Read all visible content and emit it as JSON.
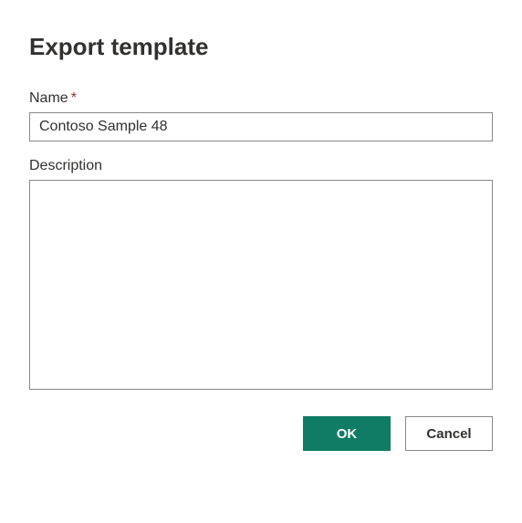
{
  "dialog": {
    "title": "Export template"
  },
  "fields": {
    "name": {
      "label": "Name",
      "required_marker": "*",
      "value": "Contoso Sample 48"
    },
    "description": {
      "label": "Description",
      "value": ""
    }
  },
  "buttons": {
    "ok": "OK",
    "cancel": "Cancel"
  },
  "colors": {
    "primary": "#107c65",
    "text": "#323130",
    "border": "#8a8886",
    "required": "#a4262c"
  }
}
